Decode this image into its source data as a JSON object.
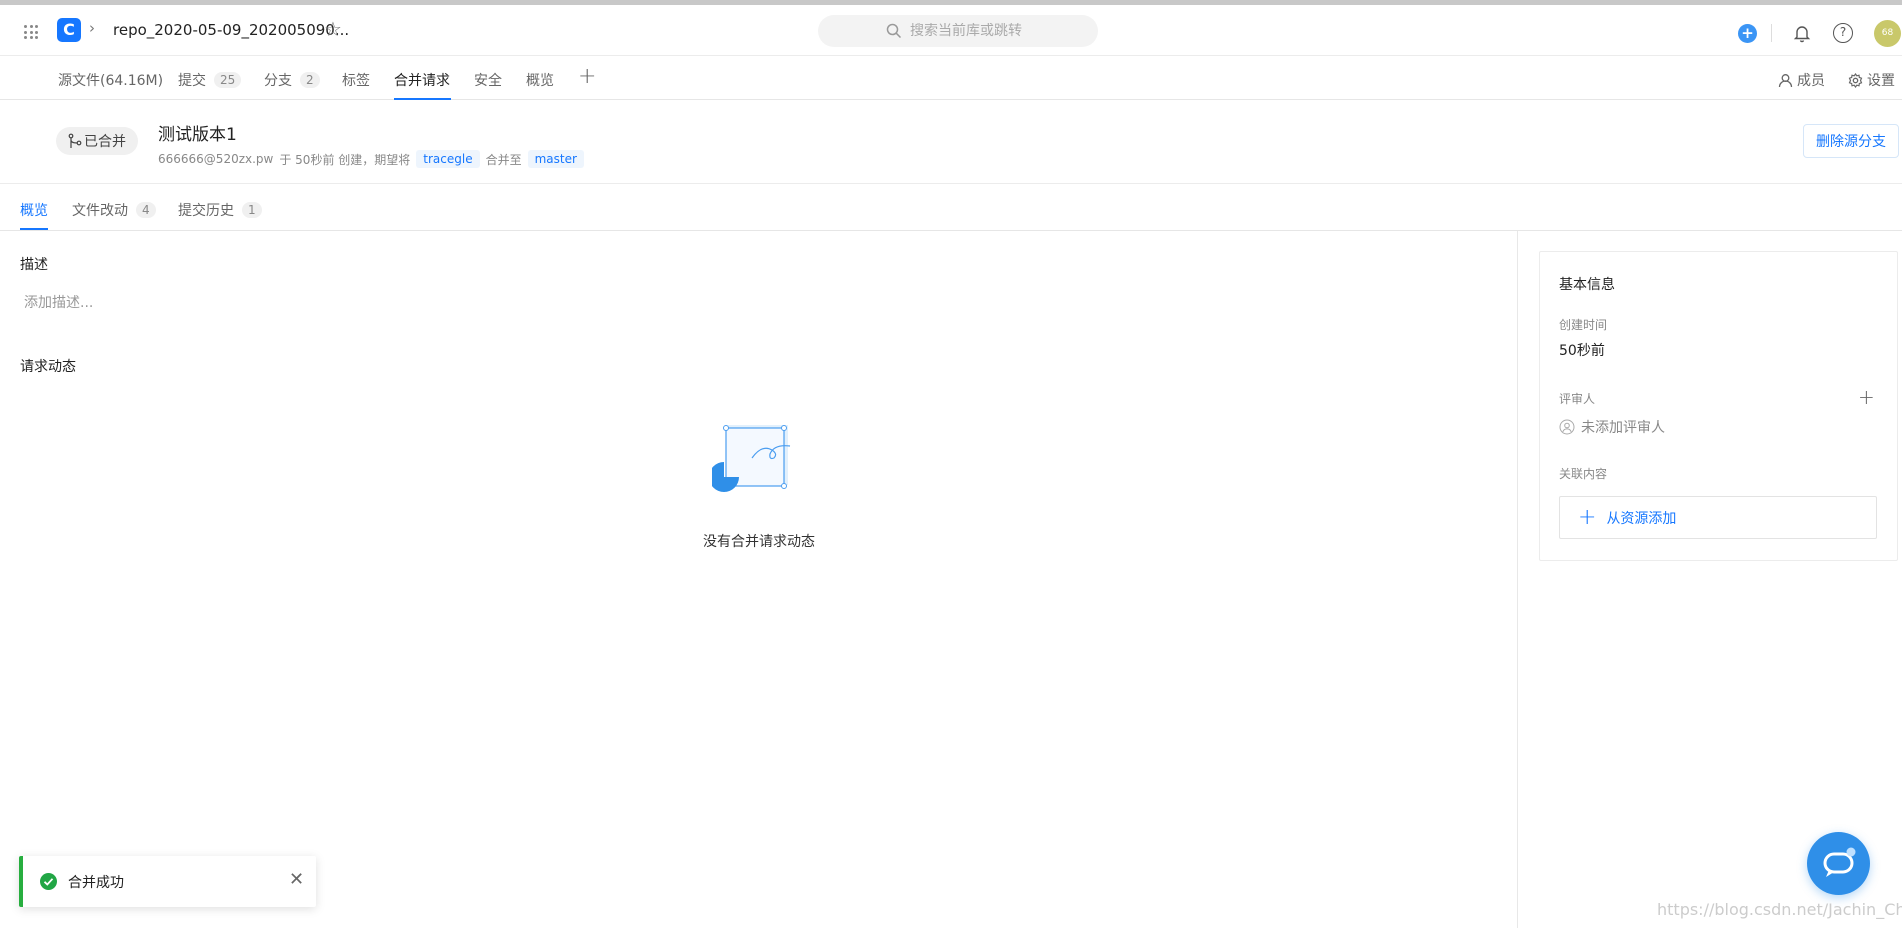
{
  "topbar": {
    "repo_name": "repo_2020-05-09_202005090...",
    "search_placeholder": "搜索当前库或跳转",
    "avatar_initials": "68",
    "accent": "#1677ff"
  },
  "nav": {
    "items": [
      {
        "label": "源文件(64.16M)",
        "count": ""
      },
      {
        "label": "提交",
        "count": "25"
      },
      {
        "label": "分支",
        "count": "2"
      },
      {
        "label": "标签",
        "count": ""
      },
      {
        "label": "合并请求",
        "count": ""
      },
      {
        "label": "安全",
        "count": ""
      },
      {
        "label": "概览",
        "count": ""
      }
    ],
    "active": "合并请求",
    "members_label": "成员",
    "settings_label": "设置"
  },
  "mr": {
    "status": "已合并",
    "title": "测试版本1",
    "author": "666666@520zx.pw",
    "meta_mid": "于 50秒前 创建，期望将",
    "source_branch": "tracegle",
    "merge_into": "合并至",
    "target_branch": "master",
    "delete_button": "删除源分支"
  },
  "subtabs": {
    "overview": "概览",
    "files": "文件改动",
    "files_count": "4",
    "history": "提交历史",
    "history_count": "1"
  },
  "main": {
    "description_title": "描述",
    "description_placeholder": "添加描述...",
    "activity_title": "请求动态",
    "empty_text": "没有合并请求动态"
  },
  "sidebar": {
    "title": "基本信息",
    "created_label": "创建时间",
    "created_value": "50秒前",
    "reviewer_label": "评审人",
    "reviewer_empty": "未添加评审人",
    "related_label": "关联内容",
    "add_resource": "从资源添加"
  },
  "toast": {
    "text": "合并成功",
    "color": "#27ae3f"
  },
  "watermark": "https://blog.csdn.net/Jachin_Chen"
}
